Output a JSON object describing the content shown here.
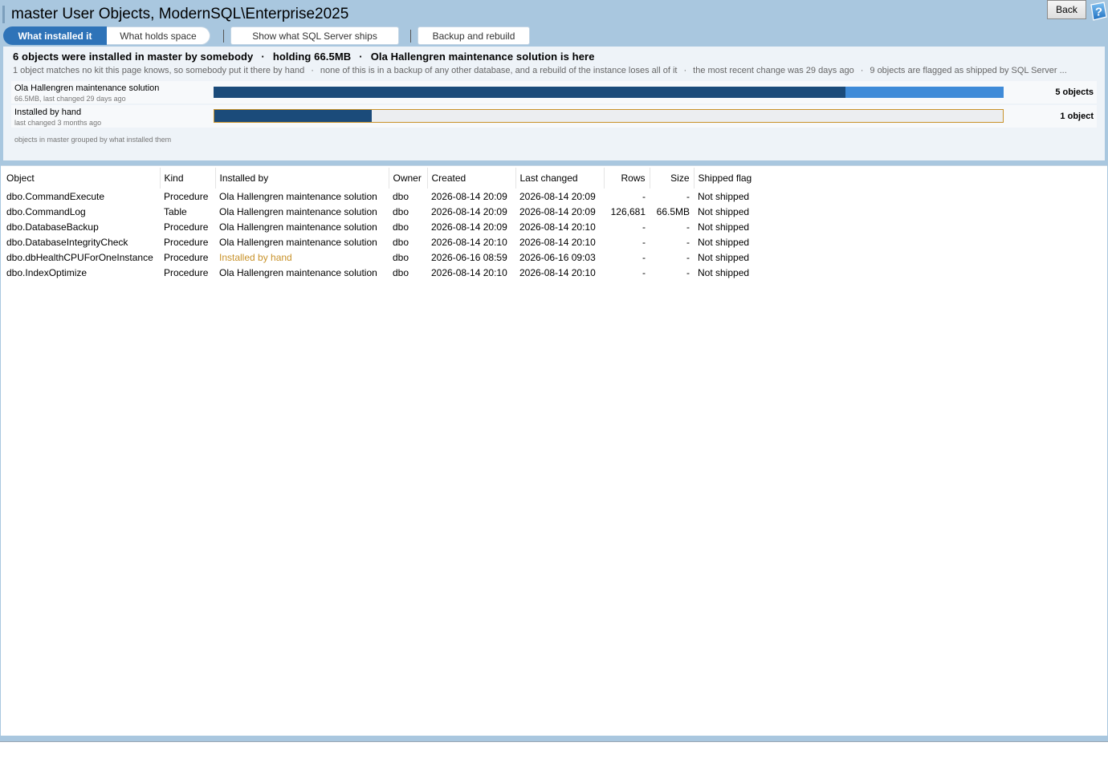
{
  "window": {
    "title": "master User Objects, ModernSQL\\Enterprise2025",
    "back_label": "Back",
    "help_icon": "help-question-icon"
  },
  "tabs": [
    {
      "label": "What installed it",
      "active": true
    },
    {
      "label": "What holds space",
      "active": false
    },
    {
      "label": "Show what SQL Server ships",
      "active": false
    },
    {
      "label": "Backup and rebuild",
      "active": false
    }
  ],
  "summary": {
    "headline": [
      "6 objects were installed in master by somebody",
      "holding 66.5MB",
      "Ola Hallengren maintenance solution is here"
    ],
    "headline_sep": "·",
    "subline": [
      "1 object matches no kit this page knows, so somebody put it there by hand",
      "none of this is in a backup of any other database, and a rebuild of the instance loses all of it",
      "the most recent change was 29 days ago",
      "9 objects are flagged as shipped by SQL Server ..."
    ],
    "subline_sep": "·",
    "groups": [
      {
        "name": "Ola Hallengren maintenance solution",
        "meta": "66.5MB, last changed 29 days ago",
        "count": "5 objects",
        "share": 0.8,
        "fill_fraction": 0.8
      },
      {
        "name": "Installed by hand",
        "meta": "last changed 3 months ago",
        "count": "1 object",
        "share": 0.2,
        "fill_fraction": 0.2
      }
    ],
    "caption": "objects in master grouped by what installed them"
  },
  "colors": {
    "accent": "#2e73b8",
    "bar_dark": "#1b4b7a",
    "bar_light": "#3f8bd8",
    "hand_highlight": "#c8922a",
    "window_bg": "#a9c7df"
  },
  "table": {
    "columns": [
      "Object",
      "Kind",
      "Installed by",
      "Owner",
      "Created",
      "Last changed",
      "Rows",
      "Size",
      "Shipped flag"
    ],
    "rows": [
      [
        "dbo.CommandExecute",
        "Procedure",
        "Ola Hallengren maintenance solution",
        "dbo",
        "2026-08-14 20:09",
        "2026-08-14 20:09",
        "-",
        "-",
        "Not shipped"
      ],
      [
        "dbo.CommandLog",
        "Table",
        "Ola Hallengren maintenance solution",
        "dbo",
        "2026-08-14 20:09",
        "2026-08-14 20:09",
        "126,681",
        "66.5MB",
        "Not shipped"
      ],
      [
        "dbo.DatabaseBackup",
        "Procedure",
        "Ola Hallengren maintenance solution",
        "dbo",
        "2026-08-14 20:09",
        "2026-08-14 20:10",
        "-",
        "-",
        "Not shipped"
      ],
      [
        "dbo.DatabaseIntegrityCheck",
        "Procedure",
        "Ola Hallengren maintenance solution",
        "dbo",
        "2026-08-14 20:10",
        "2026-08-14 20:10",
        "-",
        "-",
        "Not shipped"
      ],
      [
        "dbo.dbHealthCPUForOneInstance",
        "Procedure",
        "Installed by hand",
        "dbo",
        "2026-06-16 08:59",
        "2026-06-16 09:03",
        "-",
        "-",
        "Not shipped"
      ],
      [
        "dbo.IndexOptimize",
        "Procedure",
        "Ola Hallengren maintenance solution",
        "dbo",
        "2026-08-14 20:10",
        "2026-08-14 20:10",
        "-",
        "-",
        "Not shipped"
      ]
    ]
  }
}
